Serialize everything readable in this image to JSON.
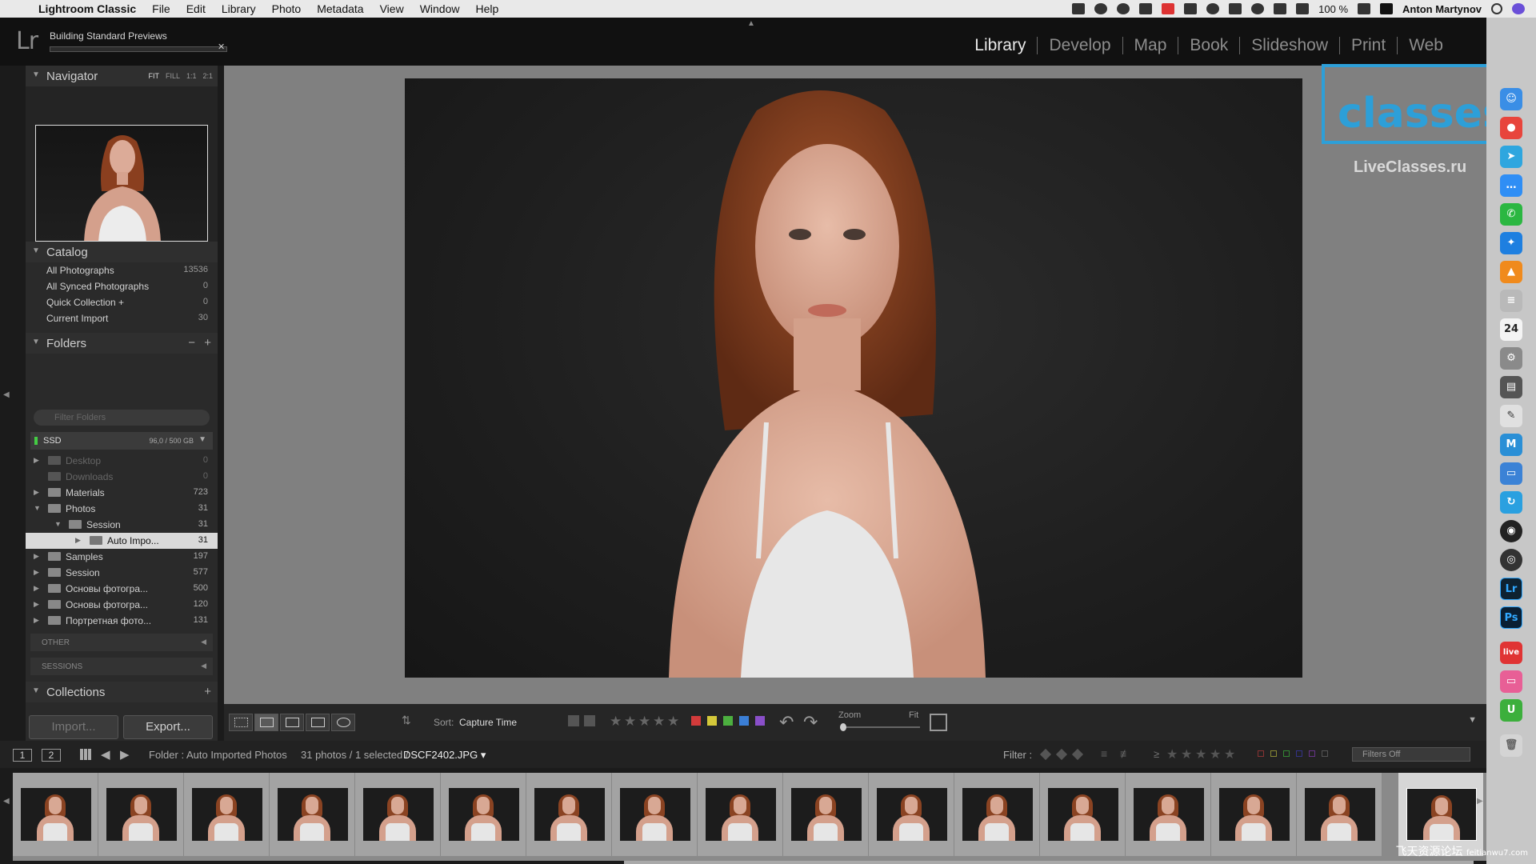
{
  "menubar": {
    "app_name": "Lightroom Classic",
    "items": [
      "File",
      "Edit",
      "Library",
      "Photo",
      "Metadata",
      "View",
      "Window",
      "Help"
    ],
    "battery": "100 %",
    "user": "Anton Martynov"
  },
  "identity": {
    "logo": "Lr",
    "activity": "Building Standard Previews",
    "activity_close": "✕",
    "modules": [
      "Library",
      "Develop",
      "Map",
      "Book",
      "Slideshow",
      "Print",
      "Web"
    ],
    "active_module": "Library"
  },
  "watermark": {
    "word": "classes",
    "url": "LiveClasses.ru"
  },
  "navigator": {
    "title": "Navigator",
    "options": [
      "FIT",
      "FILL",
      "1:1",
      "2:1"
    ],
    "selected_option": "FIT"
  },
  "catalog": {
    "title": "Catalog",
    "rows": [
      {
        "label": "All Photographs",
        "count": "13536"
      },
      {
        "label": "All Synced Photographs",
        "count": "0"
      },
      {
        "label": "Quick Collection +",
        "count": "0"
      },
      {
        "label": "Current Import",
        "count": "30"
      }
    ]
  },
  "folders": {
    "title": "Folders",
    "minus": "−",
    "plus": "+",
    "search_placeholder": "Filter Folders",
    "volume": {
      "name": "SSD",
      "capacity": "96,0 / 500 GB"
    },
    "rows": [
      {
        "label": "Desktop",
        "count": "0",
        "dim": true
      },
      {
        "label": "Downloads",
        "count": "0",
        "dim": true
      },
      {
        "label": "Materials",
        "count": "723"
      },
      {
        "label": "Photos",
        "count": "31"
      },
      {
        "label": "Session",
        "count": "31"
      },
      {
        "label": "Auto Impo...",
        "count": "31",
        "selected": true
      },
      {
        "label": "Samples",
        "count": "197"
      },
      {
        "label": "Session",
        "count": "577"
      },
      {
        "label": "Основы фотогра...",
        "count": "500"
      },
      {
        "label": "Основы фотогра...",
        "count": "120"
      },
      {
        "label": "Портретная фото...",
        "count": "131"
      }
    ],
    "other_volumes": [
      "OTHER",
      "SESSIONS"
    ]
  },
  "collections": {
    "title": "Collections",
    "plus": "+"
  },
  "buttons": {
    "import": "Import...",
    "export": "Export..."
  },
  "toolbar": {
    "sort_label": "Sort:",
    "sort_value": "Capture Time",
    "stars": [
      "★",
      "★",
      "★",
      "★",
      "★"
    ],
    "label_colors": [
      "#d23b3b",
      "#d4c83a",
      "#4caf3f",
      "#3b7fd6",
      "#8a4fc9"
    ],
    "zoom_label": "Zoom",
    "zoom_value": "Fit",
    "rotate_left": "↶",
    "rotate_right": "↷",
    "expand": "▼"
  },
  "filmstrip_bar": {
    "screen1": "1",
    "screen2": "2",
    "back": "◀",
    "forward": "▶",
    "source": "Folder : Auto Imported Photos",
    "count": "31 photos / 1 selected /",
    "file": "DSCF2402.JPG ▾",
    "filter_label": "Filter :",
    "filter_select": "Filters Off",
    "rating_op": "≥",
    "filter_stars": [
      "★",
      "★",
      "★",
      "★",
      "★"
    ]
  },
  "filmstrip": {
    "thumb_count": 17,
    "selected_index": 16
  },
  "dock": {
    "apps": [
      {
        "name": "finder-icon",
        "color": "#3a8ee6",
        "glyph": "☺"
      },
      {
        "name": "chrome-icon",
        "color": "#e8453c",
        "glyph": "●"
      },
      {
        "name": "telegram-icon",
        "color": "#2ea6df",
        "glyph": "➤"
      },
      {
        "name": "messenger-icon",
        "color": "#2f8ef5",
        "glyph": "…"
      },
      {
        "name": "whatsapp-icon",
        "color": "#2bb741",
        "glyph": "✆"
      },
      {
        "name": "safari-icon",
        "color": "#1e7fe0",
        "glyph": "✦"
      },
      {
        "name": "vlc-icon",
        "color": "#f08a1c",
        "glyph": "▲"
      },
      {
        "name": "notes-icon",
        "color": "#b9b9b9",
        "glyph": "≡"
      },
      {
        "name": "calendar-icon",
        "color": "#f4f4f4",
        "glyph": "24"
      },
      {
        "name": "settings-icon",
        "color": "#8a8a8a",
        "glyph": "⚙"
      },
      {
        "name": "filmstrip-app-icon",
        "color": "#555555",
        "glyph": "▤"
      },
      {
        "name": "script-icon",
        "color": "#e0e0e0",
        "glyph": "✎"
      },
      {
        "name": "mail-icon",
        "color": "#2a8fd6",
        "glyph": "M"
      },
      {
        "name": "keynote-icon",
        "color": "#3b82d6",
        "glyph": "▭"
      },
      {
        "name": "sync-icon",
        "color": "#2aa0e0",
        "glyph": "↻"
      },
      {
        "name": "obs-icon",
        "color": "#222222",
        "glyph": "◉"
      },
      {
        "name": "camera-icon",
        "color": "#333333",
        "glyph": "◎"
      },
      {
        "name": "lightroom-icon",
        "color": "#0e2231",
        "glyph": "Lr"
      },
      {
        "name": "photoshop-icon",
        "color": "#0a1f33",
        "glyph": "Ps"
      },
      {
        "name": "live-icon",
        "color": "#e03434",
        "glyph": "live"
      },
      {
        "name": "folder-pink-icon",
        "color": "#e85f96",
        "glyph": "▭"
      },
      {
        "name": "upwork-icon",
        "color": "#3caf3c",
        "glyph": "U"
      },
      {
        "name": "trash-icon",
        "color": "#d4d4d4",
        "glyph": "🗑"
      }
    ]
  },
  "site_watermark": {
    "text": "飞天资源论坛",
    "domain": "feitianwu7.com"
  }
}
